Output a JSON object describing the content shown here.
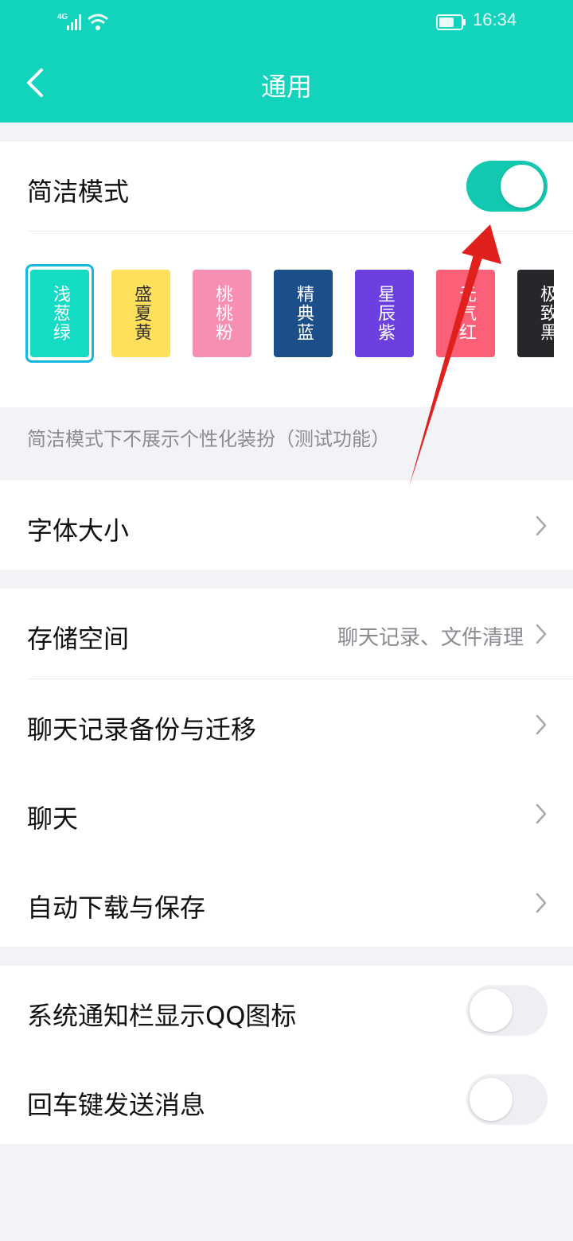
{
  "status": {
    "network": "4G",
    "time": "16:34"
  },
  "header": {
    "title": "通用"
  },
  "simple_mode": {
    "label": "简洁模式",
    "enabled": true
  },
  "themes": [
    {
      "name": "浅葱绿",
      "bg": "#14dcc4",
      "fg": "#ffffff",
      "selected": true
    },
    {
      "name": "盛夏黄",
      "bg": "#ffe05a",
      "fg": "#333333",
      "selected": false
    },
    {
      "name": "桃桃粉",
      "bg": "#f78fb0",
      "fg": "#ffffff",
      "selected": false
    },
    {
      "name": "精典蓝",
      "bg": "#1c4f8a",
      "fg": "#ffffff",
      "selected": false
    },
    {
      "name": "星辰紫",
      "bg": "#6b3fe0",
      "fg": "#ffffff",
      "selected": false
    },
    {
      "name": "元气红",
      "bg": "#fc6079",
      "fg": "#ffffff",
      "selected": false
    },
    {
      "name": "极致黑",
      "bg": "#26272b",
      "fg": "#ffffff",
      "selected": false
    }
  ],
  "simple_mode_note": "简洁模式下不展示个性化装扮（测试功能）",
  "font_size": {
    "label": "字体大小"
  },
  "storage": {
    "label": "存储空间",
    "hint": "聊天记录、文件清理"
  },
  "backup": {
    "label": "聊天记录备份与迁移"
  },
  "chat": {
    "label": "聊天"
  },
  "auto_download": {
    "label": "自动下载与保存"
  },
  "notify_icon": {
    "label": "系统通知栏显示QQ图标",
    "enabled": false
  },
  "enter_send": {
    "label": "回车键发送消息",
    "enabled": false
  },
  "colors": {
    "accent": "#12d4bd",
    "annotation_arrow": "#e0201c"
  }
}
